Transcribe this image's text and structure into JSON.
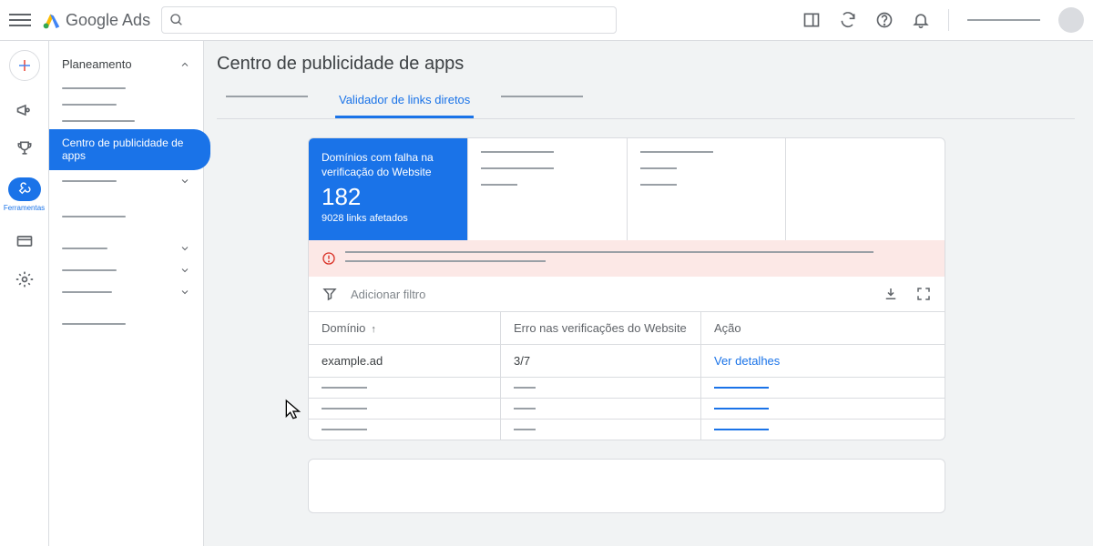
{
  "header": {
    "logo_text": "Google Ads"
  },
  "rail": {
    "tools_label": "Ferramentas"
  },
  "sidebar": {
    "section": "Planeamento",
    "selected_item": "Centro de publicidade de apps"
  },
  "page": {
    "title": "Centro de publicidade de apps",
    "active_tab": "Validador de links diretos"
  },
  "stats": {
    "active": {
      "label": "Domínios com falha na verificação do Website",
      "value": "182",
      "sub": "9028 links afetados"
    }
  },
  "filter": {
    "placeholder": "Adicionar filtro"
  },
  "table": {
    "headers": {
      "domain": "Domínio",
      "error": "Erro nas verificações do Website",
      "action": "Ação"
    },
    "rows": [
      {
        "domain": "example.ad",
        "error": "3/7",
        "action": "Ver detalhes"
      }
    ]
  }
}
